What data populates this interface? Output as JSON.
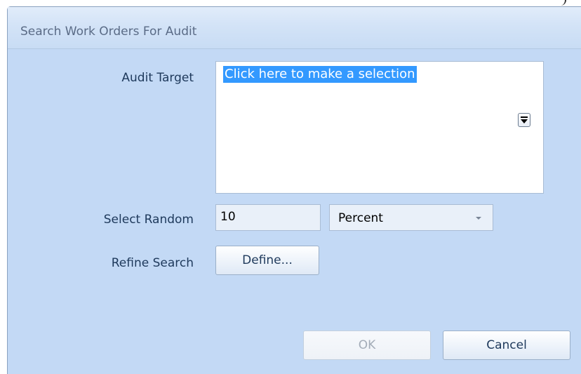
{
  "window": {
    "title": "Search Work Orders For Audit"
  },
  "audit_target": {
    "label": "Audit Target",
    "selection_text": "Click here to make a selection"
  },
  "select_random": {
    "label": "Select Random",
    "value": "10",
    "unit_selected": "Percent"
  },
  "refine_search": {
    "label": "Refine Search",
    "button_label": "Define..."
  },
  "footer": {
    "ok_label": "OK",
    "ok_enabled": false,
    "cancel_label": "Cancel"
  },
  "colors": {
    "dialog_background": "#c3d9f5",
    "selection_highlight": "#3399ff",
    "label_text": "#1e395b"
  }
}
